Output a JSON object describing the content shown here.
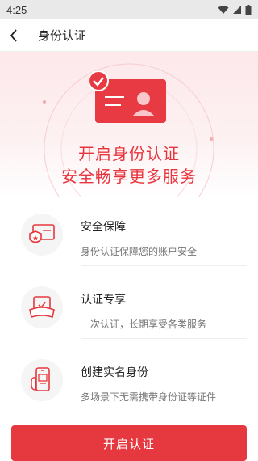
{
  "status_bar": {
    "time": "4:25"
  },
  "app_bar": {
    "title": "身份认证"
  },
  "hero": {
    "line1": "开启身份认证",
    "line2": "安全畅享更多服务"
  },
  "features": [
    {
      "icon": "shield-card-icon",
      "title": "安全保障",
      "subtitle": "身份认证保障您的账户安全"
    },
    {
      "icon": "exclusive-badge-icon",
      "title": "认证专享",
      "subtitle": "一次认证，长期享受各类服务"
    },
    {
      "icon": "phone-id-icon",
      "title": "创建实名身份",
      "subtitle": "多场景下无需携带身份证等证件"
    }
  ],
  "cta": {
    "label": "开启认证"
  },
  "colors": {
    "accent": "#e6393f",
    "hero_bg": "#fde8ea"
  }
}
